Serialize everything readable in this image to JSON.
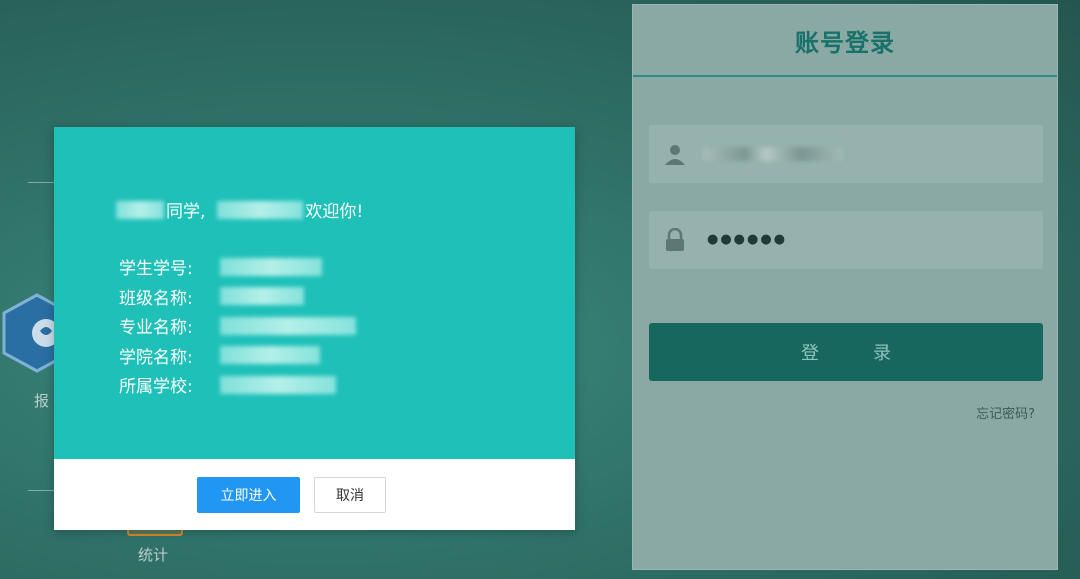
{
  "background": {
    "labels": {
      "report_partial": "报",
      "statistics": "统计"
    }
  },
  "login": {
    "title": "账号登录",
    "password_value": "●●●●●●",
    "login_button": "登　录",
    "forgot_password": "忘记密码?"
  },
  "modal": {
    "greeting_middle": "同学,",
    "greeting_end": "欢迎你!",
    "fields": [
      {
        "label": "学生学号:"
      },
      {
        "label": "班级名称:"
      },
      {
        "label": "专业名称:"
      },
      {
        "label": "学院名称:"
      },
      {
        "label": "所属学校:"
      }
    ],
    "enter_button": "立即进入",
    "cancel_button": "取消"
  },
  "colors": {
    "modal_bg": "#1ec0b8",
    "primary_button": "#2196f3",
    "login_title": "#19716a",
    "login_button": "#17675f"
  }
}
